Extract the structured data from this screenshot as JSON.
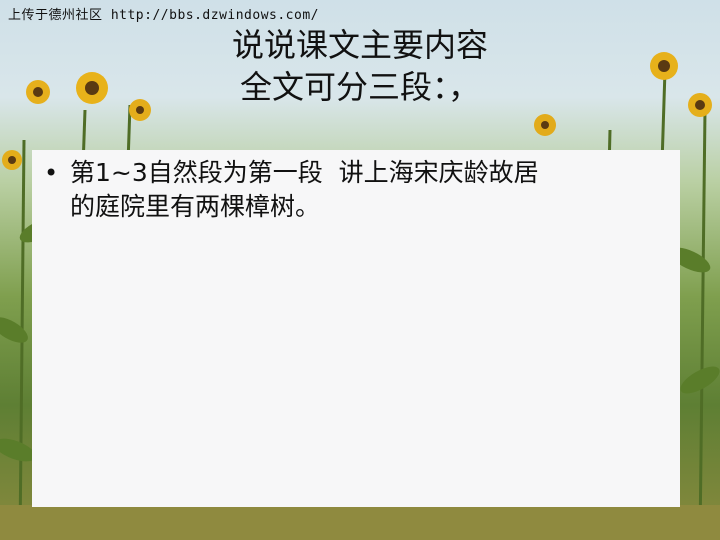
{
  "watermark": "上传于德州社区 http://bbs.dzwindows.com/",
  "title": {
    "line1": "说说课文主要内容",
    "line2": "全文可分三段：，"
  },
  "bullets": [
    {
      "text": "第1~3自然段为第一段  讲上海宋庆龄故居\n的庭院里有两棵樟树。"
    }
  ],
  "colors": {
    "content_bg": "#f7f7f8",
    "text": "#111111"
  }
}
